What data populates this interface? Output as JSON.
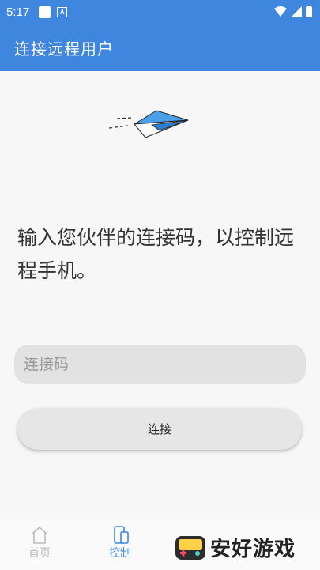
{
  "status": {
    "time": "5:17"
  },
  "header": {
    "title": "连接远程用户"
  },
  "main": {
    "prompt": "输入您伙伴的连接码，以控制远程手机。",
    "code_input": {
      "placeholder": "连接码",
      "value": ""
    },
    "connect_label": "连接"
  },
  "nav": {
    "items": [
      {
        "label": "首页",
        "icon": "home-icon",
        "active": false
      },
      {
        "label": "控制",
        "icon": "phone-icon",
        "active": true
      }
    ]
  },
  "watermark": {
    "text": "安好游戏"
  },
  "colors": {
    "primary": "#3f86de",
    "background": "#f7f7f7"
  }
}
